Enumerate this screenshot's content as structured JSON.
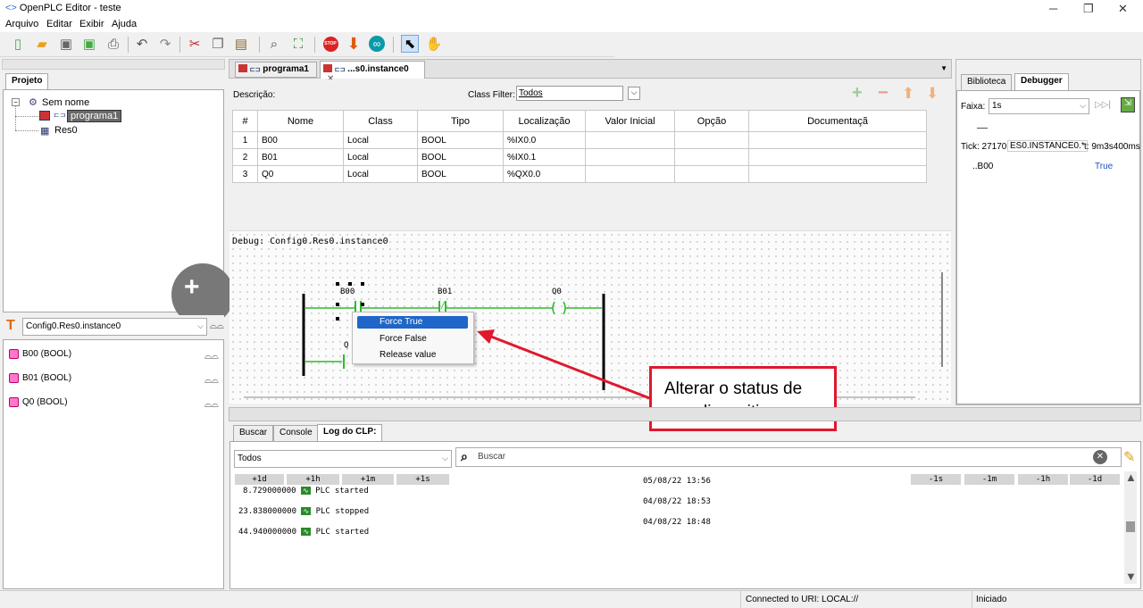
{
  "window": {
    "title": "OpenPLC Editor - teste",
    "icon": "<>",
    "minimize": "─",
    "restore": "❐",
    "close": "✕"
  },
  "menu": [
    "Arquivo",
    "Editar",
    "Exibir",
    "Ajuda"
  ],
  "project": {
    "tab": "Projeto",
    "root": "Sem nome",
    "items": [
      "programa1",
      "Res0"
    ]
  },
  "instance": {
    "selected": "Config0.Res0.instance0",
    "vars": [
      "B00 (BOOL)",
      "B01 (BOOL)",
      "Q0 (BOOL)"
    ]
  },
  "editor": {
    "tabs": [
      "programa1",
      "...s0.instance0"
    ],
    "description_label": "Descrição:",
    "class_filter_label": "Class Filter:",
    "class_filter_value": "Todos",
    "columns": [
      "#",
      "Nome",
      "Class",
      "Tipo",
      "Localização",
      "Valor Inicial",
      "Opção",
      "Documentaçã"
    ],
    "rows": [
      [
        "1",
        "B00",
        "Local",
        "BOOL",
        "%IX0.0",
        "",
        "",
        ""
      ],
      [
        "2",
        "B01",
        "Local",
        "BOOL",
        "%IX0.1",
        "",
        "",
        ""
      ],
      [
        "3",
        "Q0",
        "Local",
        "BOOL",
        "%QX0.0",
        "",
        "",
        ""
      ]
    ]
  },
  "ladder": {
    "debug_title": "Debug: Config0.Res0.instance0",
    "contacts": [
      "B00",
      "B01",
      "Q0"
    ],
    "coil_symbol": "( )",
    "nc_symbol": "/",
    "partial_label": "Q"
  },
  "context_menu": [
    "Force True",
    "Force False",
    "Release value"
  ],
  "annotation": {
    "line1": "Alterar o status de",
    "line2": "um dispositivo"
  },
  "debugger": {
    "tabs": [
      "Biblioteca",
      "Debugger"
    ],
    "range_label": "Faixa:",
    "range_value": "1s",
    "tick_label": "Tick: 27170",
    "instance_field": "ES0.INSTANCE0.*",
    "time_label": "t: 9m3s400ms",
    "var_name": "..B00",
    "var_value": "True"
  },
  "bottom": {
    "tabs": [
      "Buscar",
      "Console",
      "Log do CLP:"
    ],
    "filter": "Todos",
    "search_placeholder": "Buscar",
    "left_cols": [
      "+1d",
      "+1h",
      "+1m",
      "+1s"
    ],
    "right_cols": [
      "-1s",
      "-1m",
      "-1h",
      "-1d"
    ],
    "log": [
      {
        "offset": "8.729000000",
        "msg": "PLC started",
        "date": "05/08/22 13:56"
      },
      {
        "offset": "23.838000000",
        "msg": "PLC stopped",
        "date": "04/08/22 18:53"
      },
      {
        "offset": "44.940000000",
        "msg": "PLC started",
        "date": "04/08/22 18:48"
      }
    ]
  },
  "status": {
    "uri": "Connected to URI: LOCAL://",
    "state": "Iniciado"
  },
  "colors": {
    "selection": "#1f66c8",
    "annotation": "#e0182d",
    "energized": "#2dbb2d"
  }
}
